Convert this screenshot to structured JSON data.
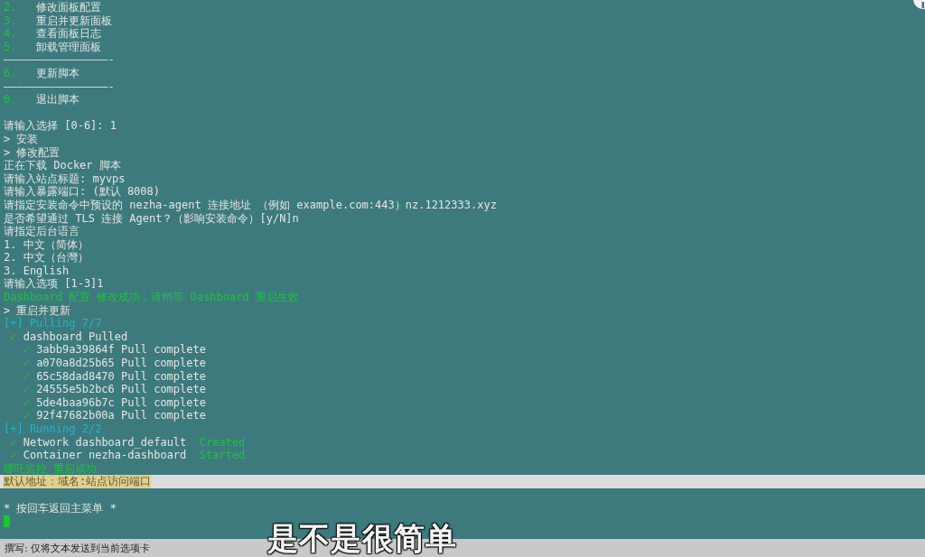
{
  "terminal": {
    "lines": [
      {
        "kind": "text",
        "segments": [
          {
            "text": "2.",
            "kind": "success"
          },
          {
            "text": "   修改面板配置",
            "kind": "plain"
          }
        ]
      },
      {
        "kind": "text",
        "segments": [
          {
            "text": "3.",
            "kind": "success"
          },
          {
            "text": "   重启并更新面板",
            "kind": "plain"
          }
        ]
      },
      {
        "kind": "text",
        "segments": [
          {
            "text": "4.",
            "kind": "success"
          },
          {
            "text": "   查看面板日志",
            "kind": "plain"
          }
        ]
      },
      {
        "kind": "text",
        "segments": [
          {
            "text": "5.",
            "kind": "success"
          },
          {
            "text": "   卸载管理面板",
            "kind": "plain"
          }
        ]
      },
      {
        "kind": "text",
        "segments": [
          {
            "text": "————————————————-",
            "kind": "plain"
          }
        ]
      },
      {
        "kind": "text",
        "segments": [
          {
            "text": "6.",
            "kind": "success"
          },
          {
            "text": "   更新脚本",
            "kind": "plain"
          }
        ]
      },
      {
        "kind": "text",
        "segments": [
          {
            "text": "————————————————-",
            "kind": "plain"
          }
        ]
      },
      {
        "kind": "text",
        "segments": [
          {
            "text": "0.",
            "kind": "success"
          },
          {
            "text": "   退出脚本",
            "kind": "plain"
          }
        ]
      },
      {
        "kind": "blank"
      },
      {
        "kind": "text",
        "segments": [
          {
            "text": "请输入选择 [0-6]: 1",
            "kind": "plain"
          }
        ]
      },
      {
        "kind": "text",
        "segments": [
          {
            "text": "> 安装",
            "kind": "plain"
          }
        ]
      },
      {
        "kind": "text",
        "segments": [
          {
            "text": "> 修改配置",
            "kind": "plain"
          }
        ]
      },
      {
        "kind": "text",
        "segments": [
          {
            "text": "正在下载 Docker 脚本",
            "kind": "plain"
          }
        ]
      },
      {
        "kind": "text",
        "segments": [
          {
            "text": "请输入站点标题: myvps",
            "kind": "plain"
          }
        ]
      },
      {
        "kind": "text",
        "segments": [
          {
            "text": "请输入暴露端口: (默认 8008)",
            "kind": "plain"
          }
        ]
      },
      {
        "kind": "text",
        "segments": [
          {
            "text": "请指定安装命令中预设的 nezha-agent 连接地址 （例如 example.com:443）nz.1212333.xyz",
            "kind": "plain"
          }
        ]
      },
      {
        "kind": "text",
        "segments": [
          {
            "text": "是否希望通过 TLS 连接 Agent？（影响安装命令）[y/N]n",
            "kind": "plain"
          }
        ]
      },
      {
        "kind": "text",
        "segments": [
          {
            "text": "请指定后台语言",
            "kind": "plain"
          }
        ]
      },
      {
        "kind": "text",
        "segments": [
          {
            "text": "1. 中文（简体）",
            "kind": "plain"
          }
        ]
      },
      {
        "kind": "text",
        "segments": [
          {
            "text": "2. 中文（台灣）",
            "kind": "plain"
          }
        ]
      },
      {
        "kind": "text",
        "segments": [
          {
            "text": "3. English",
            "kind": "plain"
          }
        ]
      },
      {
        "kind": "text",
        "segments": [
          {
            "text": "请输入选项 [1-3]1",
            "kind": "plain"
          }
        ]
      },
      {
        "kind": "text",
        "segments": [
          {
            "text": "Dashboard 配置 修改成功，请稍等 Dashboard 重启生效",
            "kind": "success"
          }
        ]
      },
      {
        "kind": "text",
        "segments": [
          {
            "text": "> 重启并更新",
            "kind": "plain"
          }
        ]
      },
      {
        "kind": "text",
        "segments": [
          {
            "text": "[+] Pulling 7/7",
            "kind": "info"
          }
        ]
      },
      {
        "kind": "text",
        "segments": [
          {
            "text": " ✓ ",
            "kind": "success"
          },
          {
            "text": "dashboard Pulled",
            "kind": "plain"
          }
        ]
      },
      {
        "kind": "text",
        "segments": [
          {
            "text": "   ✓ ",
            "kind": "success"
          },
          {
            "text": "3abb9a39864f Pull complete",
            "kind": "plain"
          }
        ]
      },
      {
        "kind": "text",
        "segments": [
          {
            "text": "   ✓ ",
            "kind": "success"
          },
          {
            "text": "a070a8d25b65 Pull complete",
            "kind": "plain"
          }
        ]
      },
      {
        "kind": "text",
        "segments": [
          {
            "text": "   ✓ ",
            "kind": "success"
          },
          {
            "text": "65c58dad8470 Pull complete",
            "kind": "plain"
          }
        ]
      },
      {
        "kind": "text",
        "segments": [
          {
            "text": "   ✓ ",
            "kind": "success"
          },
          {
            "text": "24555e5b2bc6 Pull complete",
            "kind": "plain"
          }
        ]
      },
      {
        "kind": "text",
        "segments": [
          {
            "text": "   ✓ ",
            "kind": "success"
          },
          {
            "text": "5de4baa96b7c Pull complete",
            "kind": "plain"
          }
        ]
      },
      {
        "kind": "text",
        "segments": [
          {
            "text": "   ✓ ",
            "kind": "success"
          },
          {
            "text": "92f47682b00a Pull complete",
            "kind": "plain"
          }
        ]
      },
      {
        "kind": "text",
        "segments": [
          {
            "text": "[+] Running 2/2",
            "kind": "info"
          }
        ]
      },
      {
        "kind": "text",
        "segments": [
          {
            "text": " ✓ ",
            "kind": "success"
          },
          {
            "text": "Network dashboard_default  ",
            "kind": "plain"
          },
          {
            "text": "Created",
            "kind": "success"
          }
        ]
      },
      {
        "kind": "text",
        "segments": [
          {
            "text": " ✓ ",
            "kind": "success"
          },
          {
            "text": "Container nezha-dashboard  ",
            "kind": "plain"
          },
          {
            "text": "Started",
            "kind": "success"
          }
        ]
      },
      {
        "kind": "text",
        "segments": [
          {
            "text": "哪吒监控 重启成功",
            "kind": "success"
          }
        ]
      },
      {
        "kind": "highlight",
        "segments": [
          {
            "text": "默认地址：域名:站点访问端口",
            "kind": "selected"
          }
        ]
      },
      {
        "kind": "blank"
      },
      {
        "kind": "text",
        "segments": [
          {
            "text": "* 按回车返回主菜单 *",
            "kind": "plain"
          }
        ]
      },
      {
        "kind": "cursor"
      }
    ]
  },
  "status_bar": {
    "text": "撰写: 仅将文本发送到当前选项卡"
  },
  "subtitle": "是不是很简单"
}
